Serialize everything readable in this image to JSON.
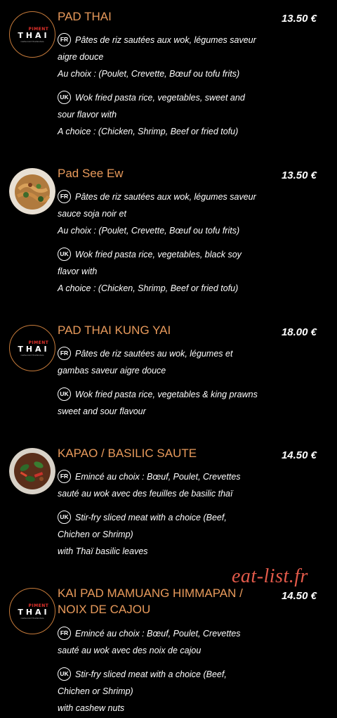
{
  "brand": {
    "piment": "PIMENT",
    "thai": "THAI",
    "tagline": "restaurant thaïlandais"
  },
  "watermark": "eat-list.fr",
  "items": [
    {
      "title": "PAD THAI",
      "price": "13.50 €",
      "fr_badge": "FR",
      "uk_badge": "UK",
      "fr_lines": [
        "Pâtes de riz sautées aux wok, légumes saveur",
        "aigre douce",
        "Au choix : (Poulet, Crevette, Bœuf ou tofu frits)"
      ],
      "uk_lines": [
        "Wok fried pasta rice, vegetables, sweet and",
        "sour flavor with",
        "A choice : (Chicken, Shrimp, Beef or fried tofu)"
      ]
    },
    {
      "title": "Pad See Ew",
      "price": "13.50 €",
      "fr_badge": "FR",
      "uk_badge": "UK",
      "fr_lines": [
        "Pâtes de riz sautées aux wok, légumes saveur",
        "sauce soja noir et",
        "Au choix : (Poulet, Crevette, Bœuf ou tofu frits)"
      ],
      "uk_lines": [
        "Wok fried pasta rice, vegetables, black soy",
        "flavor with",
        "A choice : (Chicken, Shrimp, Beef or fried tofu)"
      ]
    },
    {
      "title": "PAD THAI KUNG YAI",
      "price": "18.00 €",
      "fr_badge": "FR",
      "uk_badge": "UK",
      "fr_lines": [
        "Pâtes de riz sautées au wok, légumes et",
        "gambas saveur aigre douce"
      ],
      "uk_lines": [
        "Wok fried pasta rice, vegetables & king prawns",
        "sweet and sour flavour"
      ]
    },
    {
      "title": "KAPAO / BASILIC SAUTE",
      "price": "14.50 €",
      "fr_badge": "FR",
      "uk_badge": "UK",
      "fr_lines": [
        "Emincé au choix : Bœuf, Poulet, Crevettes",
        "sauté au wok avec des feuilles de basilic thaï"
      ],
      "uk_lines": [
        "Stir-fry sliced meat with a choice (Beef,",
        "Chichen or Shrimp)",
        "with Thaï basilic leaves"
      ]
    },
    {
      "title_line1": "KAI PAD MAMUANG HIMMAPAN /",
      "title_line2": "NOIX DE CAJOU",
      "price": "14.50 €",
      "fr_badge": "FR",
      "uk_badge": "UK",
      "fr_lines": [
        "Emincé au choix : Bœuf, Poulet, Crevettes",
        "sauté au wok avec des noix de cajou"
      ],
      "uk_lines": [
        "Stir-fry sliced meat with a choice (Beef,",
        "Chichen or Shrimp)",
        "with cashew nuts"
      ]
    }
  ]
}
